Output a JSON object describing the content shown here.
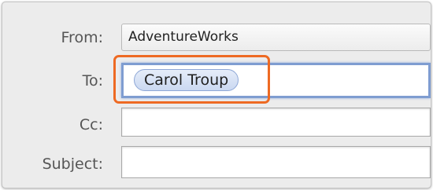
{
  "compose": {
    "from": {
      "label": "From:",
      "value": "AdventureWorks"
    },
    "to": {
      "label": "To:",
      "recipients": [
        "Carol Troup"
      ]
    },
    "cc": {
      "label": "Cc:",
      "value": ""
    },
    "subject": {
      "label": "Subject:",
      "value": ""
    }
  },
  "colors": {
    "highlight": "#ee6a23",
    "focus_ring": "#7f9dd1",
    "token_fill": "#cad8f1"
  }
}
